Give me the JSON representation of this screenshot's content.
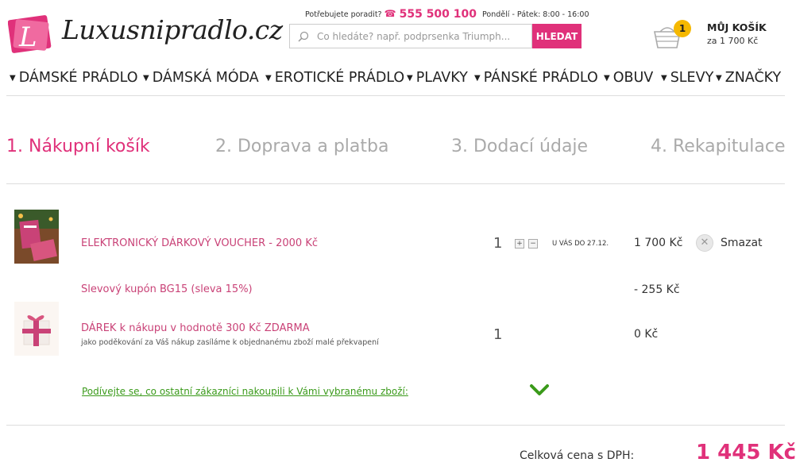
{
  "header": {
    "brand": "Luxusnipradlo.cz",
    "help_label": "Potřebujete poradit?",
    "phone": "555 500 100",
    "hours": "Pondělí - Pátek: 8:00 - 16:00",
    "search_placeholder": "Co hledáte? např. podprsenka Triumph...",
    "search_button": "HLEDAT",
    "cart_count": "1",
    "cart_title": "MŮJ KOŠÍK",
    "cart_sum": "za  1 700 Kč"
  },
  "nav": [
    {
      "label": "DÁMSKÉ PRÁDLO"
    },
    {
      "label": "DÁMSKÁ MÓDA"
    },
    {
      "label": "EROTICKÉ PRÁDLO"
    },
    {
      "label": "PLAVKY"
    },
    {
      "label": "PÁNSKÉ PRÁDLO"
    },
    {
      "label": "OBUV"
    },
    {
      "label": "SLEVY"
    },
    {
      "label": "ZNAČKY"
    }
  ],
  "steps": [
    {
      "label": "1. Nákupní košík"
    },
    {
      "label": "2. Doprava a platba"
    },
    {
      "label": "3. Dodací údaje"
    },
    {
      "label": "4. Rekapitulace"
    }
  ],
  "items": {
    "voucher": {
      "name": "ELEKTRONICKÝ DÁRKOVÝ VOUCHER - 2000 Kč",
      "qty": "1",
      "plus": "+",
      "minus": "−",
      "availability": "U VÁS DO 27.12.",
      "price": "1 700 Kč",
      "delete_label": "Smazat"
    },
    "coupon": {
      "name": "Slevový kupón BG15 (sleva 15%)",
      "price": "- 255 Kč"
    },
    "gift": {
      "name": "DÁREK k nákupu v hodnotě 300 Kč ZDARMA",
      "note": "jako poděkování za Váš nákup zasíláme k objednanému zboží malé překvapení",
      "qty": "1",
      "price": "0 Kč"
    }
  },
  "others_link": "Podívejte se, co ostatní zákazníci nakoupili k Vámi vybranému zboží:",
  "total": {
    "label": "Celková cena s DPH:",
    "value": "1 445 Kč"
  },
  "colors": {
    "accent": "#e0317a",
    "product_link": "#c94277",
    "green": "#3a9a1a",
    "badge": "#f5b800"
  }
}
